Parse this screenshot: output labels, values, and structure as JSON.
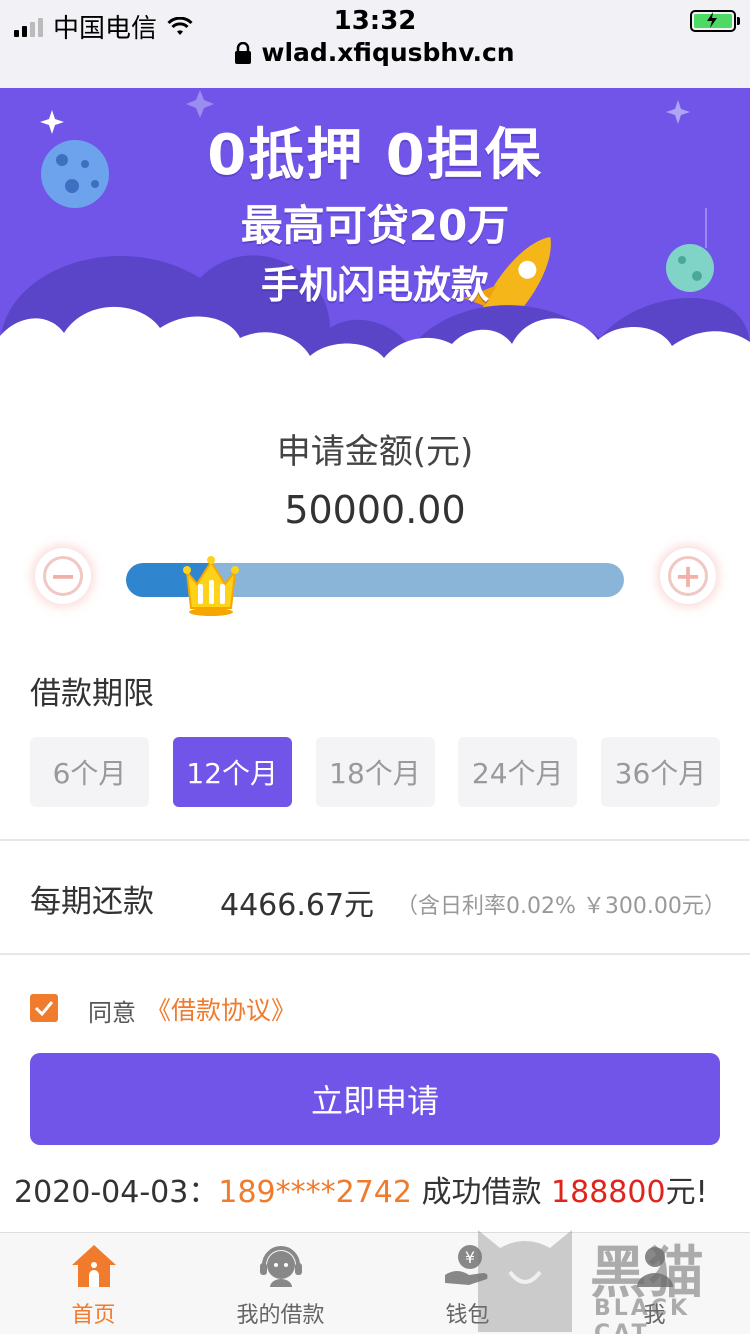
{
  "status_bar": {
    "carrier": "中国电信",
    "time": "13:32",
    "url": "wlad.xfiqusbhv.cn"
  },
  "banner": {
    "line1": "0抵押 0担保",
    "line2": "最高可贷20万",
    "line3": "手机闪电放款"
  },
  "loan": {
    "amount_label": "申请金额(元)",
    "amount_value": "50000.00",
    "slider_fraction": 0.17
  },
  "term": {
    "label": "借款期限",
    "options": [
      "6个月",
      "12个月",
      "18个月",
      "24个月",
      "36个月"
    ],
    "selected": "12个月"
  },
  "repayment": {
    "label": "每期还款",
    "value": "4466.67元",
    "note": "（含日利率0.02% ￥300.00元）"
  },
  "agreement": {
    "agree_text": "同意",
    "link_text": "《借款协议》"
  },
  "submit_label": "立即申请",
  "ticker": {
    "date": "2020-04-03：",
    "phone": "189****2742",
    "middle": " 成功借款 ",
    "amount": "188800",
    "suffix": "元!"
  },
  "tabbar": {
    "items": [
      {
        "label": "首页",
        "icon": "home-icon"
      },
      {
        "label": "我的借款",
        "icon": "service-icon"
      },
      {
        "label": "钱包",
        "icon": "wallet-icon"
      },
      {
        "label": "我",
        "icon": "user-icon"
      }
    ]
  },
  "watermark": {
    "text": "黑猫",
    "sub": "BLACK CAT"
  },
  "colors": {
    "primary": "#7155e8",
    "accent": "#f07b2d",
    "highlight": "#e0241b"
  }
}
